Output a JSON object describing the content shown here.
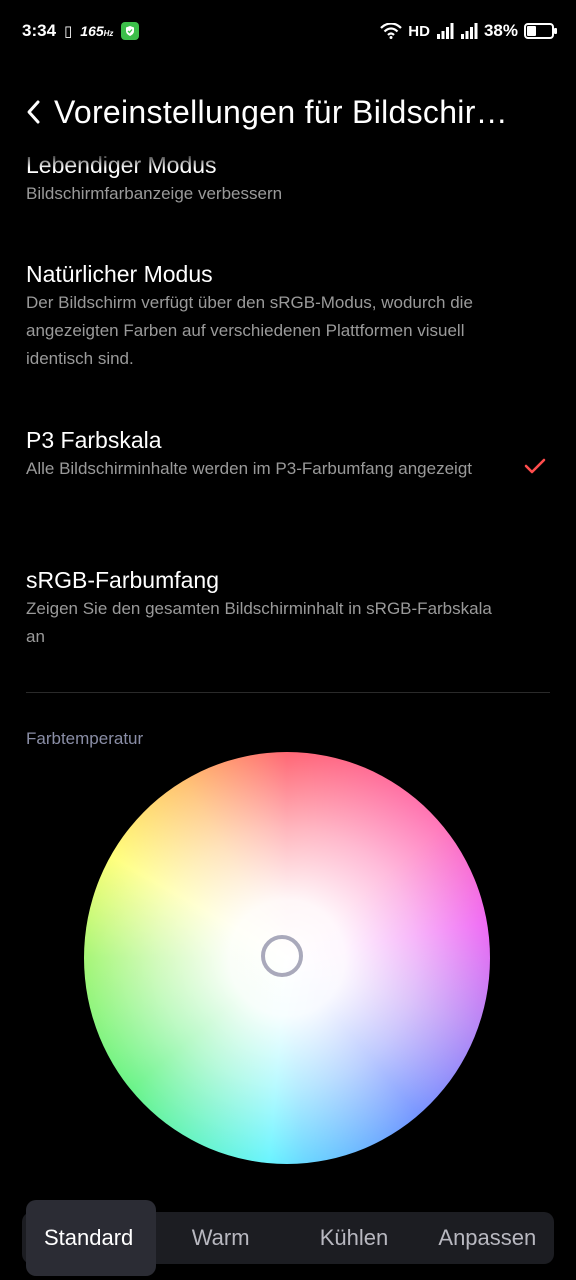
{
  "status_bar": {
    "time": "3:34",
    "refresh_rate": "165",
    "refresh_unit": "Hz",
    "network": "HD",
    "battery_percent": "38%",
    "battery_level": 0.38
  },
  "header": {
    "title": "Voreinstellungen für Bildschir…"
  },
  "options": [
    {
      "title": "Lebendiger Modus",
      "description": "Bildschirmfarbanzeige verbessern",
      "selected": false
    },
    {
      "title": "Natürlicher Modus",
      "description": "Der Bildschirm verfügt über den sRGB-Modus, wodurch die angezeigten Farben auf verschiedenen Plattformen visuell identisch sind.",
      "selected": false
    },
    {
      "title": "P3 Farbskala",
      "description": "Alle Bildschirminhalte werden im P3-Farbumfang angezeigt",
      "selected": true
    },
    {
      "title": "sRGB-Farbumfang",
      "description": "Zeigen Sie den gesamten Bildschirminhalt in sRGB-Farbskala an",
      "selected": false
    }
  ],
  "color_temperature": {
    "label": "Farbtemperatur"
  },
  "tabs": [
    {
      "label": "Standard",
      "active": true
    },
    {
      "label": "Warm",
      "active": false
    },
    {
      "label": "Kühlen",
      "active": false
    },
    {
      "label": "Anpassen",
      "active": false
    }
  ],
  "colors": {
    "accent_check": "#ff4d4d",
    "background": "#000000",
    "secondary_text": "#9a9a9a"
  }
}
